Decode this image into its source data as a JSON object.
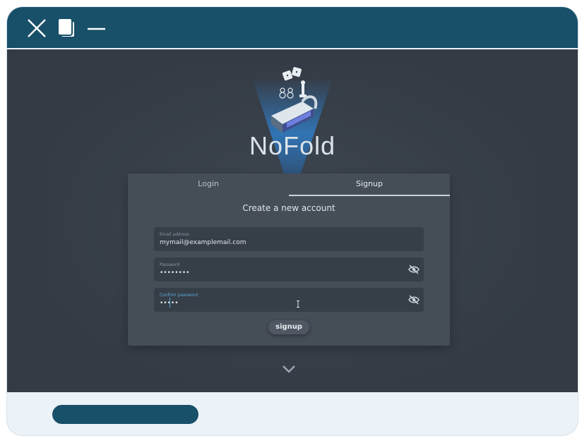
{
  "window": {
    "controls": {
      "close": "close-icon",
      "restore": "restore-icon",
      "minimize": "minimize-icon"
    }
  },
  "app": {
    "name": "NoFold"
  },
  "auth": {
    "tabs": [
      {
        "label": "Login",
        "active": false
      },
      {
        "label": "Signup",
        "active": true
      }
    ],
    "title": "Create a new account",
    "fields": {
      "email": {
        "label": "Email address",
        "value": "mymail@examplemail.com"
      },
      "password": {
        "label": "Password",
        "value": "••••••••"
      },
      "confirm": {
        "label": "Confirm password",
        "value": "•••••"
      }
    },
    "submit_label": "signup"
  },
  "colors": {
    "titlebar": "#184f69",
    "background": "#343b44",
    "card": "#454d56",
    "field": "#363e47",
    "accent": "#5aa8dc",
    "footer": "#ebf3f8"
  }
}
